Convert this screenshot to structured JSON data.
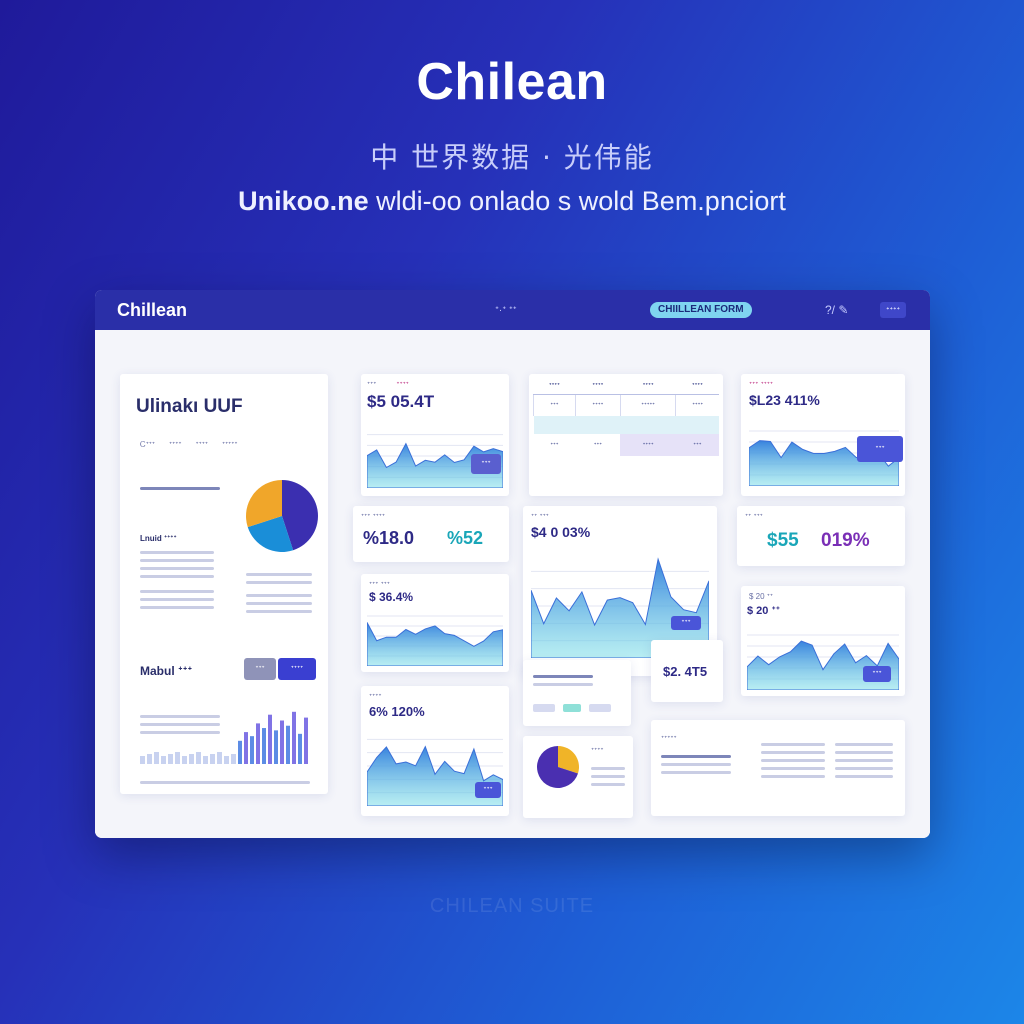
{
  "hero": {
    "title": "Chilean",
    "cjk_line": "中 世界数据 · 光伟能",
    "subtitle_bold": "Unikoo.ne",
    "subtitle_rest": " wldi-oo onlado s wold Bem.pnciort",
    "footer_ghost": "CHILEAN SUITE"
  },
  "topbar": {
    "brand": "Chillean",
    "nav_link": "ᐩ·ᐩ ᐩᐩ",
    "nav_pill": "CHIILLEAN FORM",
    "nav_icon": "?/ ✎",
    "nav_button": "ᐩᐩᐩᐩ"
  },
  "left_panel": {
    "title": "Ulinakı UUF",
    "sub_tabs": [
      "Ꮯᐩᐩᐩ",
      "ᐩᐩᐩᐩ",
      "ᐩᐩᐩᐩ",
      "ᐩᐩᐩᐩᐩ"
    ],
    "section_a": "Lnuid ᐩᐩᐩᐩ",
    "section_b": "Mabul ᐩᐩᐩ",
    "button_secondary": "ᐩᐩᐩ",
    "button_primary": "ᐩᐩᐩᐩ",
    "pie": [
      {
        "label": "A",
        "value": 45,
        "color": "#3b2fb0"
      },
      {
        "label": "B",
        "value": 25,
        "color": "#1a8ed8"
      },
      {
        "label": "C",
        "value": 30,
        "color": "#f0a62a"
      }
    ],
    "bars": [
      40,
      55,
      48,
      70,
      62,
      85,
      58,
      75,
      66,
      90,
      52,
      80
    ]
  },
  "cards": {
    "c1": {
      "label": "ᐩᐩᐩ",
      "label2": "ᐩᐩᐩᐩ",
      "value": "$5 05.4T",
      "btn": "ᐩᐩᐩ"
    },
    "table": {
      "headers": [
        "ᐩᐩᐩᐩ",
        "ᐩᐩᐩᐩ",
        "ᐩᐩᐩᐩ",
        "ᐩᐩᐩᐩ"
      ],
      "rows": [
        [
          "ᐩᐩᐩ",
          "ᐩᐩᐩᐩ",
          "ᐩᐩᐩᐩᐩ",
          "ᐩᐩᐩᐩ"
        ],
        [
          "ᐩᐩᐩ",
          "ᐩᐩᐩ",
          "ᐩᐩᐩᐩ",
          "ᐩᐩᐩ"
        ]
      ]
    },
    "c3": {
      "label": "ᐩᐩᐩ ᐩᐩᐩᐩ",
      "value": "$L23 411%",
      "btn": "ᐩᐩᐩ"
    },
    "c4": {
      "label": "ᐩᐩᐩ ᐩᐩᐩᐩ",
      "value": "%18.0",
      "value2": "%52"
    },
    "c5": {
      "label": "ᐩᐩ ᐩᐩᐩ",
      "value": "$4 0 03%",
      "btn": "ᐩᐩᐩ"
    },
    "c6": {
      "label": "ᐩᐩ ᐩᐩᐩ",
      "value": "$55",
      "value2": "019%"
    },
    "c7": {
      "label": "ᐩᐩᐩ ᐩᐩᐩ",
      "value": "$ 36.4%"
    },
    "c8": {
      "value": "$2. 4T5"
    },
    "c9": {
      "label": "$ 20 ᐩᐩ",
      "value": "$ 20 ᐩᐩ",
      "btn": "ᐩᐩᐩ"
    },
    "c10": {
      "label": "ᐩᐩᐩᐩ",
      "value": "6% 120%",
      "btn": "ᐩᐩᐩ"
    },
    "c11": {
      "label": "ᐩᐩᐩᐩ"
    },
    "c12": {
      "label": "ᐩᐩᐩᐩᐩ"
    }
  },
  "colors": {
    "accent": "#3a3fd1",
    "teal": "#1aa6b8",
    "pink": "#c23e8a"
  }
}
